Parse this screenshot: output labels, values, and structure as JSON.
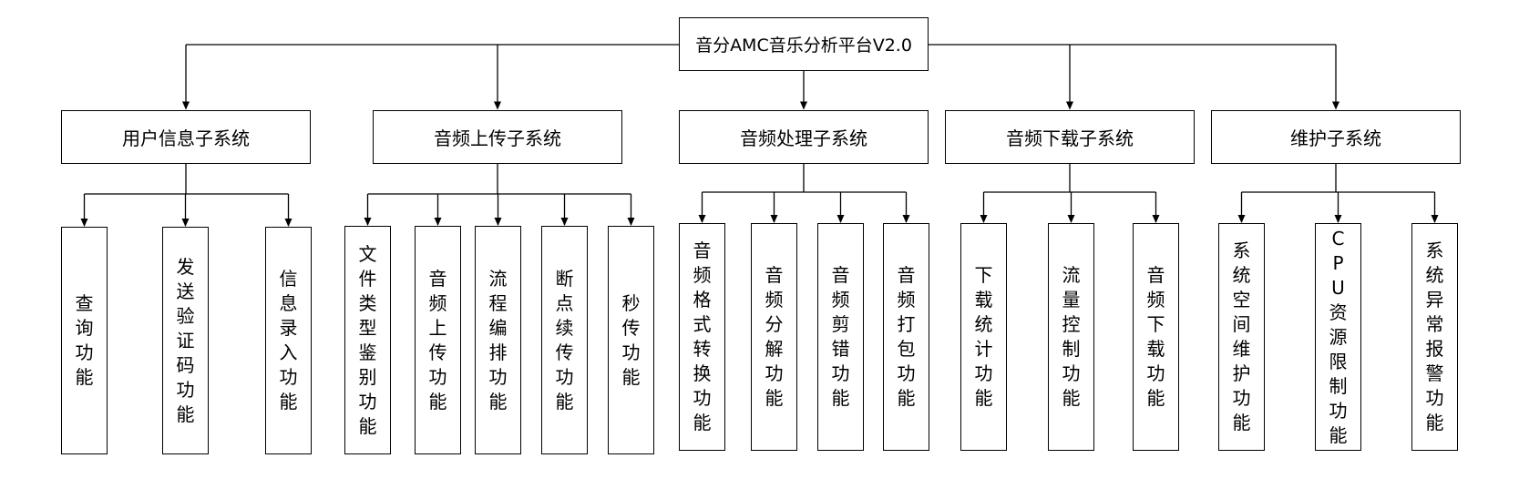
{
  "diagram": {
    "root": "音分AMC音乐分析平台V2.0",
    "subsystems": [
      {
        "name": "用户信息子系统",
        "functions": [
          "查询功能",
          "发送验证码功能",
          "信息录入功能"
        ]
      },
      {
        "name": "音频上传子系统",
        "functions": [
          "文件类型鉴别功能",
          "音频上传功能",
          "流程编排功能",
          "断点续传功能",
          "秒传功能"
        ]
      },
      {
        "name": "音频处理子系统",
        "functions": [
          "音频格式转换功能",
          "音频分解功能",
          "音频剪错功能",
          "音频打包功能"
        ]
      },
      {
        "name": "音频下载子系统",
        "functions": [
          "下载统计功能",
          "流量控制功能",
          "音频下载功能"
        ]
      },
      {
        "name": "维护子系统",
        "functions": [
          "系统空间维护功能",
          "CPU资源限制功能",
          "系统异常报警功能"
        ]
      }
    ]
  }
}
